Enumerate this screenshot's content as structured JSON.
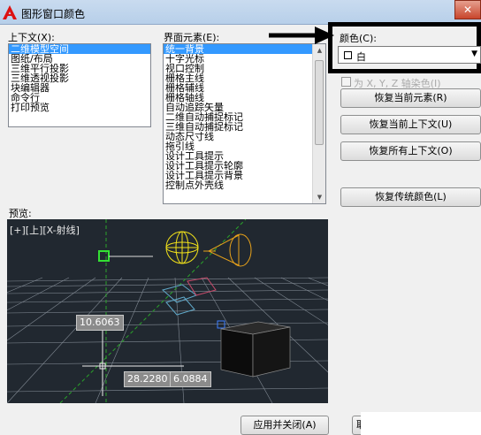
{
  "window": {
    "title": "图形窗口颜色",
    "close_label": "✕"
  },
  "context": {
    "label": "上下文(X):",
    "items": [
      "二维模型空间",
      "图纸/布局",
      "三维平行投影",
      "三维透视投影",
      "块编辑器",
      "命令行",
      "打印预览"
    ]
  },
  "elements": {
    "label": "界面元素(E):",
    "items": [
      "统一背景",
      "十字光标",
      "视口控制",
      "栅格主线",
      "栅格辅线",
      "栅格轴线",
      "自动追踪矢量",
      "二维自动捕捉标记",
      "三维自动捕捉标记",
      "动态尺寸线",
      "拖引线",
      "设计工具提示",
      "设计工具提示轮廓",
      "设计工具提示背景",
      "控制点外壳线"
    ]
  },
  "color": {
    "label": "颜色(C):",
    "value": "白",
    "tint_checkbox_label": "为 X, Y, Z 轴染色(I)"
  },
  "buttons": {
    "restore_current_element": "恢复当前元素(R)",
    "restore_current_context": "恢复当前上下文(U)",
    "restore_all_contexts": "恢复所有上下文(O)",
    "restore_classic_colors": "恢复传统颜色(L)",
    "apply_close": "应用并关闭(A)",
    "cancel": "取"
  },
  "preview": {
    "label": "预览:",
    "viewport_label": "[+][上][X-射线]",
    "dim1": "10.6063",
    "dim2": "28.2280",
    "dim3": "6.0884"
  },
  "colors": {
    "title_bar": "#c4d7ee",
    "selection": "#3399ff",
    "preview_bg": "#212830",
    "arrow_annotation": "#000000"
  }
}
